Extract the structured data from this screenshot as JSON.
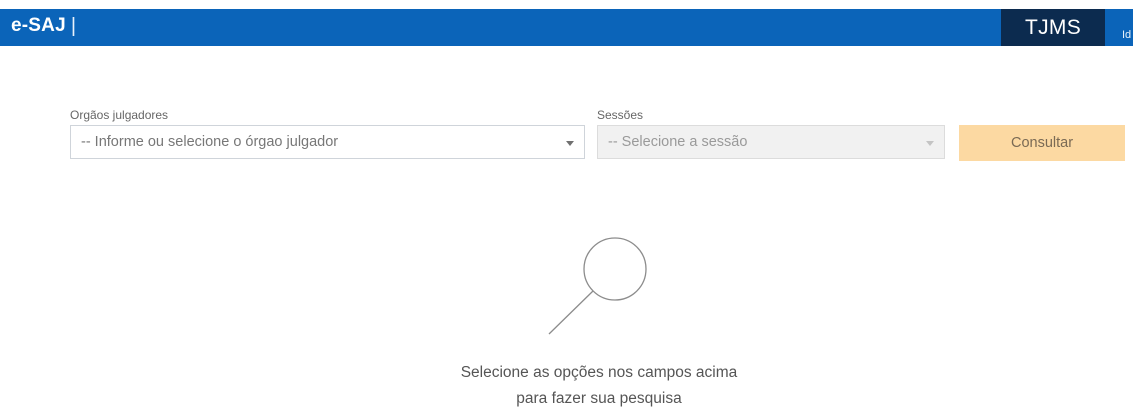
{
  "header": {
    "app_name": "e-SAJ",
    "separator": "|",
    "org_name": "TJMS",
    "user_link_partial": "Id",
    "bar_color": "#0b64b9",
    "org_badge_color": "#0c2b4f"
  },
  "filters": {
    "orgaos": {
      "label": "Orgãos julgadores",
      "placeholder": "-- Informe ou selecione o órgao julgador"
    },
    "sessoes": {
      "label": "Sessões",
      "placeholder": "-- Selecione a sessão",
      "disabled": true
    },
    "consult_button": {
      "label": "Consultar",
      "color": "#fcd9a2"
    }
  },
  "empty_state": {
    "icon": "magnifier-icon",
    "line1": "Selecione as opções nos campos acima",
    "line2": "para fazer sua pesquisa"
  }
}
